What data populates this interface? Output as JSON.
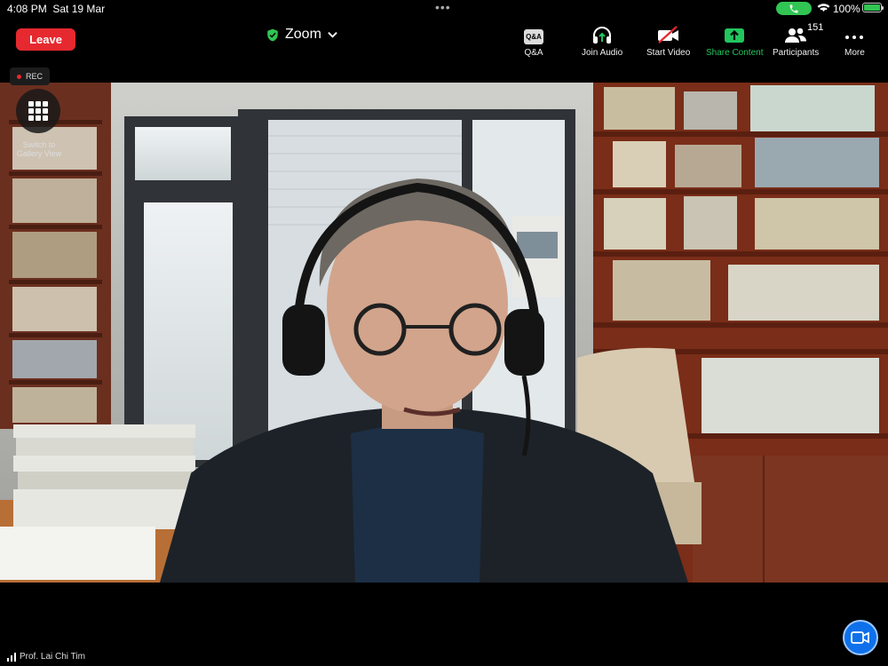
{
  "status_bar": {
    "time": "4:08 PM",
    "date": "Sat 19 Mar",
    "battery": "100%",
    "battery_level": 1.0
  },
  "toolbar": {
    "leave_label": "Leave",
    "meeting_title": "Zoom",
    "qa_icon_text": "Q&A",
    "qa_label": "Q&A",
    "join_audio_label": "Join Audio",
    "start_video_label": "Start Video",
    "share_content_label": "Share Content",
    "participants_label": "Participants",
    "participants_count": "151",
    "more_label": "More"
  },
  "video": {
    "rec_label": "REC",
    "gallery_label": "Switch to Gallery View",
    "speaker_name": "Prof. Lai Chi Tim"
  },
  "colors": {
    "leave": "#e5292f",
    "share_green": "#22c55e",
    "shield_green": "#31c553",
    "camera_blue": "#0e71eb"
  }
}
